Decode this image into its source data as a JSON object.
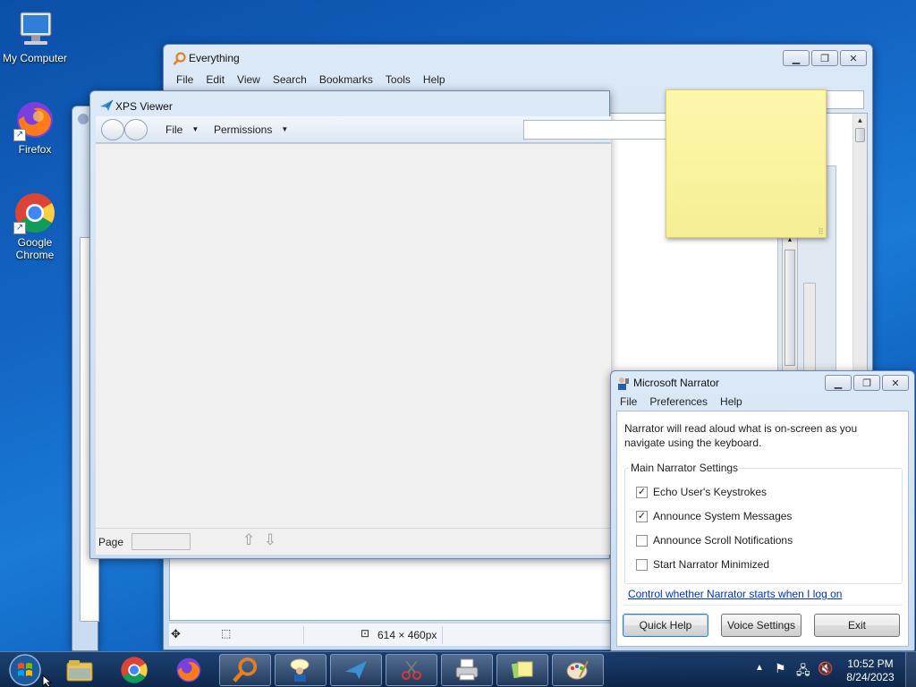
{
  "desktop": {
    "icons": [
      {
        "label": "My Computer"
      },
      {
        "label": "Firefox"
      },
      {
        "label": "Google Chrome"
      }
    ]
  },
  "everything_window": {
    "title": "Everything",
    "menu": [
      "File",
      "Edit",
      "View",
      "Search",
      "Bookmarks",
      "Tools",
      "Help"
    ],
    "status_dimensions": "614 × 460px"
  },
  "xps_window": {
    "title": "XPS Viewer",
    "menu": {
      "file": "File",
      "permissions": "Permissions"
    },
    "page_label": "Page",
    "page_value": ""
  },
  "narrator_window": {
    "title": "Microsoft Narrator",
    "menu": [
      "File",
      "Preferences",
      "Help"
    ],
    "description": "Narrator will read aloud what is on-screen as you navigate using the keyboard.",
    "group_label": "Main Narrator Settings",
    "options": [
      {
        "label": "Echo User's Keystrokes",
        "checked": true
      },
      {
        "label": "Announce System Messages",
        "checked": true
      },
      {
        "label": "Announce Scroll Notifications",
        "checked": false
      },
      {
        "label": "Start Narrator Minimized",
        "checked": false
      }
    ],
    "link": "Control whether Narrator starts when I log on",
    "buttons": {
      "quick_help": "Quick Help",
      "voice_settings": "Voice Settings",
      "exit": "Exit"
    }
  },
  "sticky_note": {
    "text": ""
  },
  "taskbar": {
    "apps": [
      "start-orb",
      "file-explorer",
      "chrome",
      "firefox",
      "everything",
      "narrator",
      "xps-viewer",
      "snipping-tool",
      "fax-scan",
      "sticky-notes",
      "paint"
    ],
    "clock": {
      "time": "10:52 PM",
      "date": "8/24/2023"
    }
  },
  "colors": {
    "accent_link": "#0033cc",
    "sticky_yellow": "#f9f3a0"
  }
}
